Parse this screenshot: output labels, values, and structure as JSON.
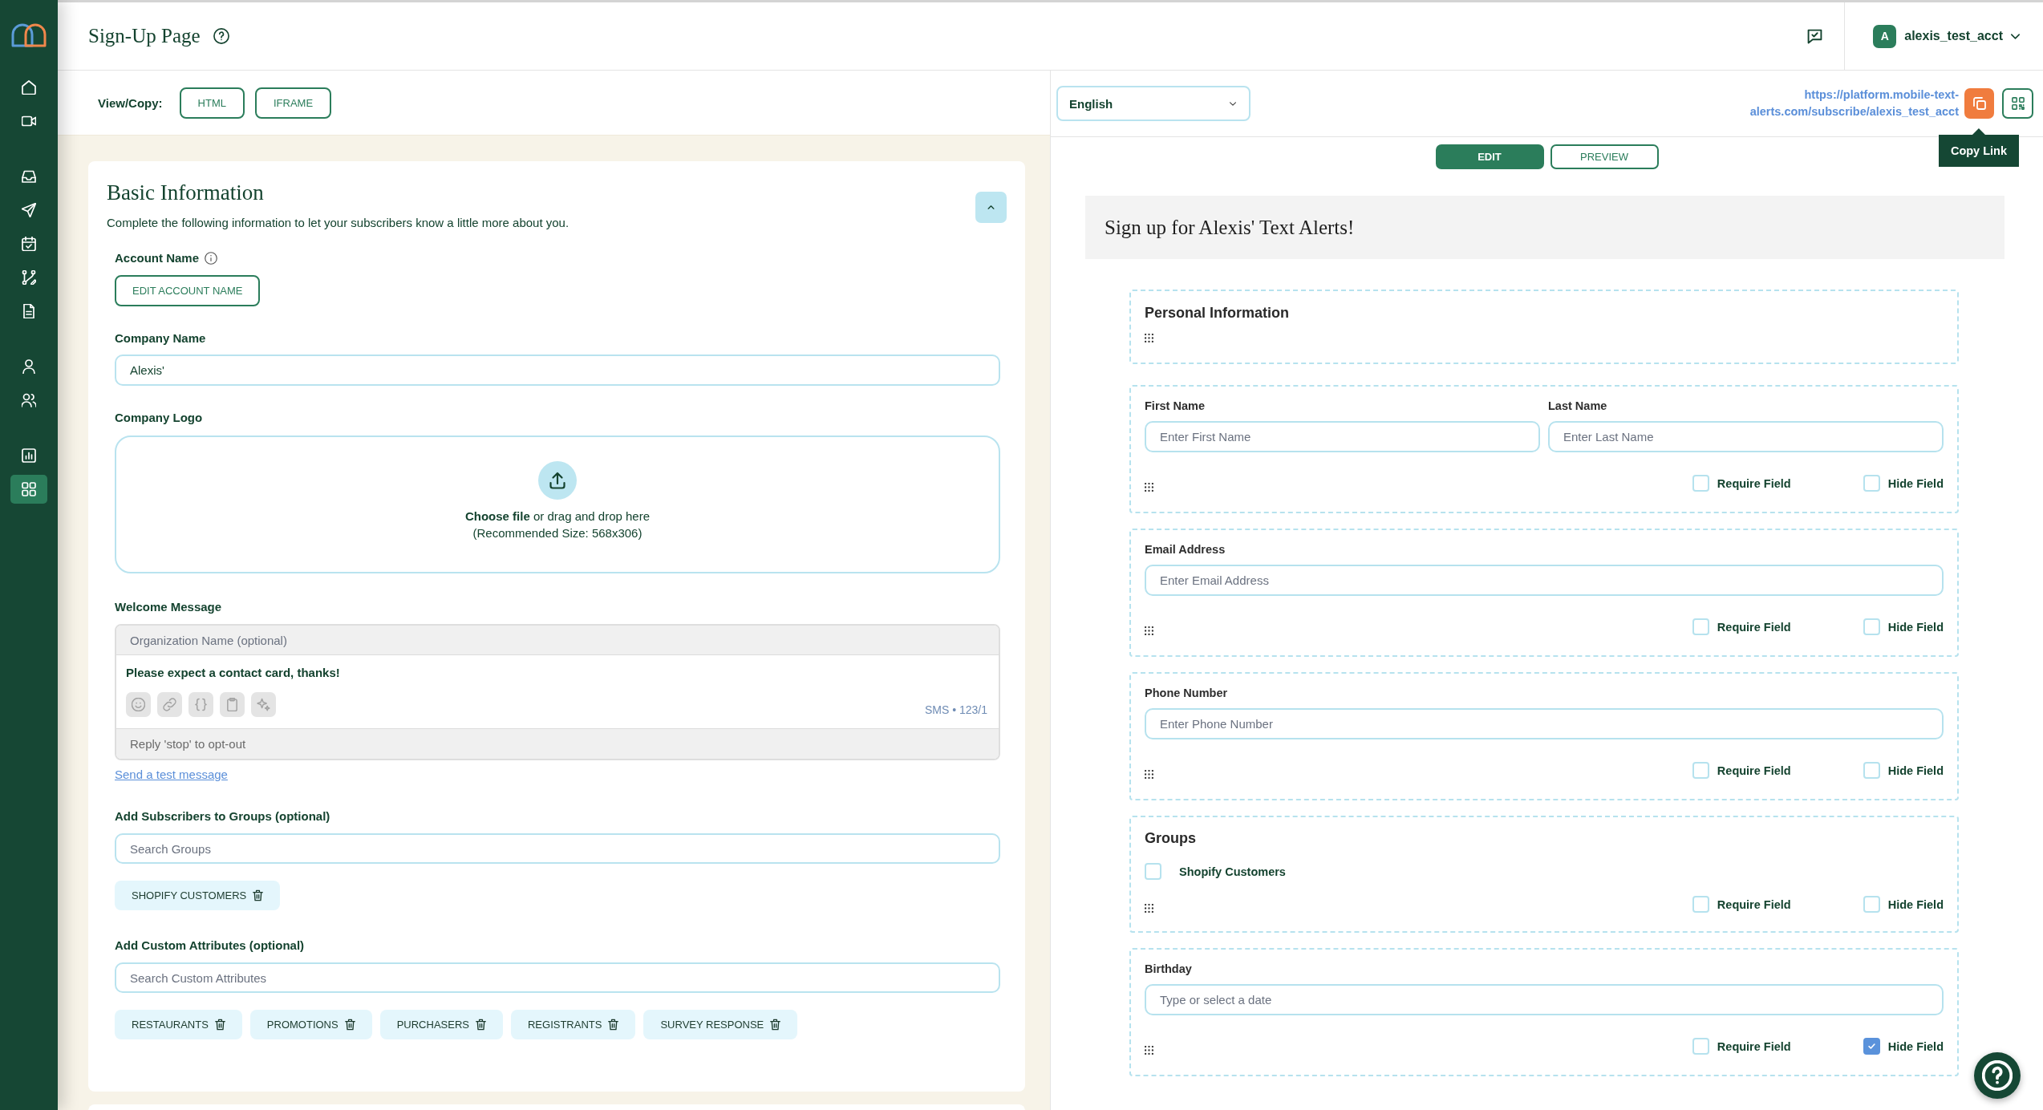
{
  "sidebar": {
    "groups": [
      {
        "items": [
          {
            "selected": false
          },
          {
            "selected": false
          }
        ]
      },
      {
        "items": [
          {
            "selected": false
          },
          {
            "selected": false
          },
          {
            "selected": false
          },
          {
            "selected": false
          },
          {
            "selected": false
          }
        ]
      },
      {
        "items": [
          {
            "selected": false
          },
          {
            "selected": false
          }
        ]
      },
      {
        "items": [
          {
            "selected": false
          },
          {
            "selected": true
          }
        ]
      }
    ]
  },
  "header": {
    "title": "Sign-Up Page",
    "account": {
      "avatar": "A",
      "name": "alexis_test_acct"
    }
  },
  "view_copy": {
    "label": "View/Copy:",
    "buttons": [
      "HTML",
      "IFRAME"
    ]
  },
  "basic_information": {
    "title": "Basic Information",
    "expanded": true,
    "description": "Complete the following information to let your subscribers know a little more about you.",
    "account_name": {
      "label": "Account Name",
      "button": "EDIT ACCOUNT NAME"
    },
    "company_name": {
      "label": "Company Name",
      "value": "Alexis'"
    },
    "company_logo": {
      "label": "Company Logo",
      "prompt": "**Choose file** or drag and drop here",
      "hint": "(Recommended Size: 568x306)"
    },
    "welcome_message": {
      "label": "Welcome Message",
      "organization_name": {
        "placeholder": "Organization Name (optional)"
      },
      "body": "Please expect a contact card, thanks!",
      "counter": "SMS • 123/1",
      "footer": "Reply 'stop' to opt-out"
    },
    "test_link": "Send a test message",
    "groups": {
      "label": "Add Subscribers to Groups (optional)",
      "placeholder": "Search Groups",
      "tags": [
        "SHOPIFY CUSTOMERS"
      ]
    },
    "custom_attributes": {
      "label": "Add Custom Attributes (optional)",
      "placeholder": "Search Custom Attributes",
      "tags": [
        "RESTAURANTS",
        "PROMOTIONS",
        "PURCHASERS",
        "REGISTRANTS",
        "SURVEY RESPONSE"
      ]
    }
  },
  "preview_toolbar": {
    "language": "English",
    "link": "https://platform.mobile-text-alerts.com/subscribe/alexis_test_acct",
    "tooltip": "Copy Link"
  },
  "modes": [
    {
      "label": "EDIT",
      "selected": true
    },
    {
      "label": "PREVIEW",
      "selected": false
    }
  ],
  "form": {
    "title": "Sign up for Alexis' Text Alerts!",
    "blocks": [
      {
        "kind": "section",
        "title": "Personal Information"
      },
      {
        "kind": "inputs",
        "fields": [
          {
            "label": "First Name",
            "placeholder": "Enter First Name"
          },
          {
            "label": "Last Name",
            "placeholder": "Enter Last Name"
          }
        ],
        "settings": [
          {
            "label": "Require Field",
            "checked": false
          },
          {
            "label": "Hide Field",
            "checked": false
          }
        ]
      },
      {
        "kind": "inputs",
        "fields": [
          {
            "label": "Email Address",
            "placeholder": "Enter Email Address"
          }
        ],
        "settings": [
          {
            "label": "Require Field",
            "checked": false
          },
          {
            "label": "Hide Field",
            "checked": false
          }
        ]
      },
      {
        "kind": "inputs",
        "fields": [
          {
            "label": "Phone Number",
            "placeholder": "Enter Phone Number"
          }
        ],
        "settings": [
          {
            "label": "Require Field",
            "checked": false
          },
          {
            "label": "Hide Field",
            "checked": false
          }
        ]
      },
      {
        "kind": "options",
        "title": "Groups",
        "options": [
          {
            "label": "Shopify Customers",
            "checked": false
          }
        ],
        "settings": [
          {
            "label": "Require Field",
            "checked": false
          },
          {
            "label": "Hide Field",
            "checked": false
          }
        ]
      },
      {
        "kind": "inputs",
        "fields": [
          {
            "label": "Birthday",
            "placeholder": "Type or select a date"
          }
        ],
        "settings": [
          {
            "label": "Require Field",
            "checked": false
          },
          {
            "label": "Hide Field",
            "checked": true
          }
        ]
      }
    ]
  }
}
